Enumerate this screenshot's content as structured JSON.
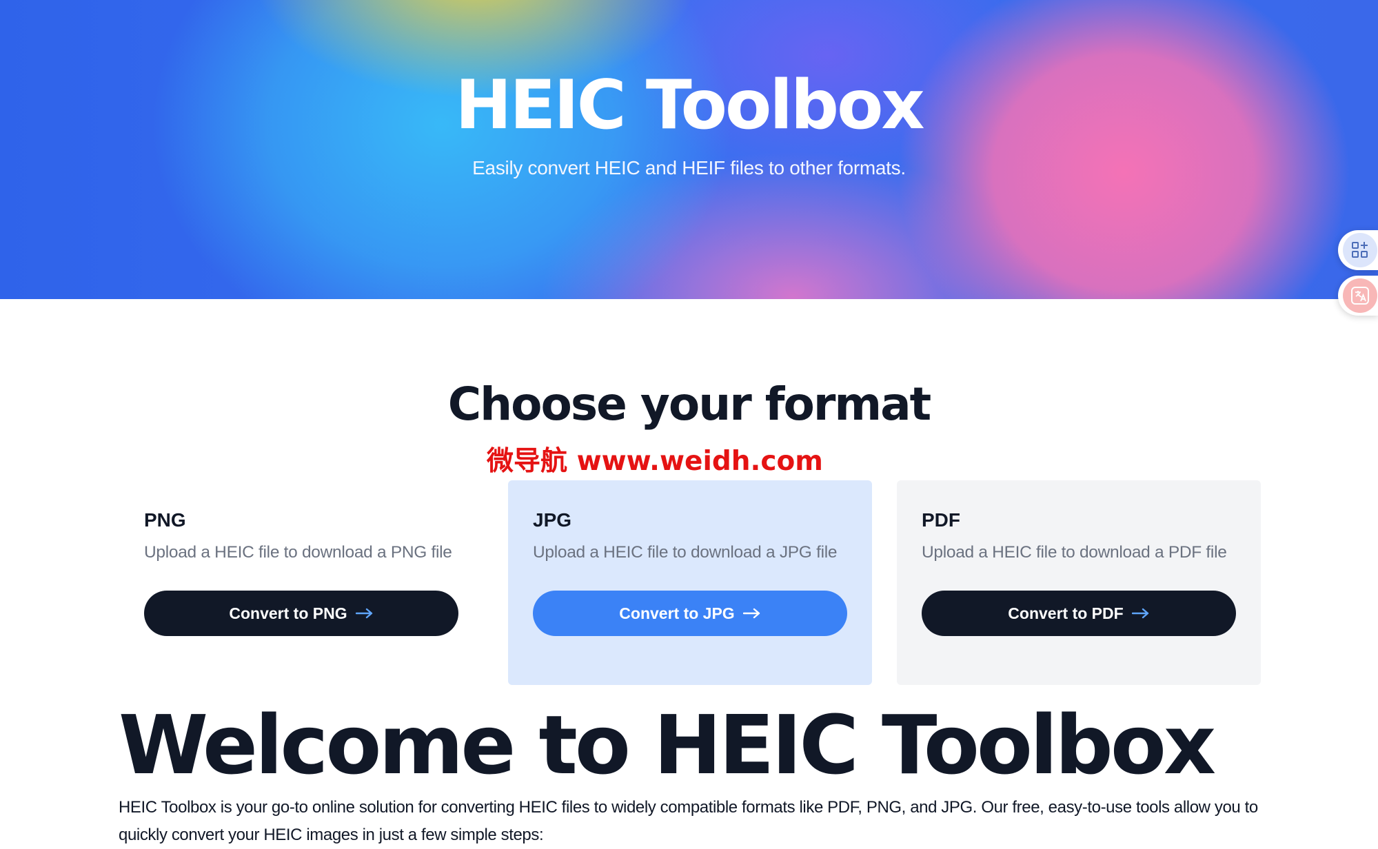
{
  "hero": {
    "title": "HEIC Toolbox",
    "subtitle": "Easily convert HEIC and HEIF files to other formats."
  },
  "side_widgets": [
    {
      "icon": "apps-add-icon"
    },
    {
      "icon": "translate-icon"
    }
  ],
  "formats_section": {
    "title": "Choose your format",
    "watermark": "微导航 www.weidh.com",
    "cards": [
      {
        "title": "PNG",
        "description": "Upload a HEIC file to download a PNG file",
        "button_label": "Convert to PNG",
        "button_color": "#111827",
        "background": "#ffffff"
      },
      {
        "title": "JPG",
        "description": "Upload a HEIC file to download a JPG file",
        "button_label": "Convert to JPG",
        "button_color": "#3b82f6",
        "background": "#dbe8fd"
      },
      {
        "title": "PDF",
        "description": "Upload a HEIC file to download a PDF file",
        "button_label": "Convert to PDF",
        "button_color": "#111827",
        "background": "#f3f4f6"
      }
    ]
  },
  "welcome": {
    "title": "Welcome to HEIC Toolbox",
    "intro": "HEIC Toolbox is your go-to online solution for converting HEIC files to widely compatible formats like PDF, PNG, and JPG. Our free, easy-to-use tools allow you to quickly convert your HEIC images in just a few simple steps:"
  }
}
